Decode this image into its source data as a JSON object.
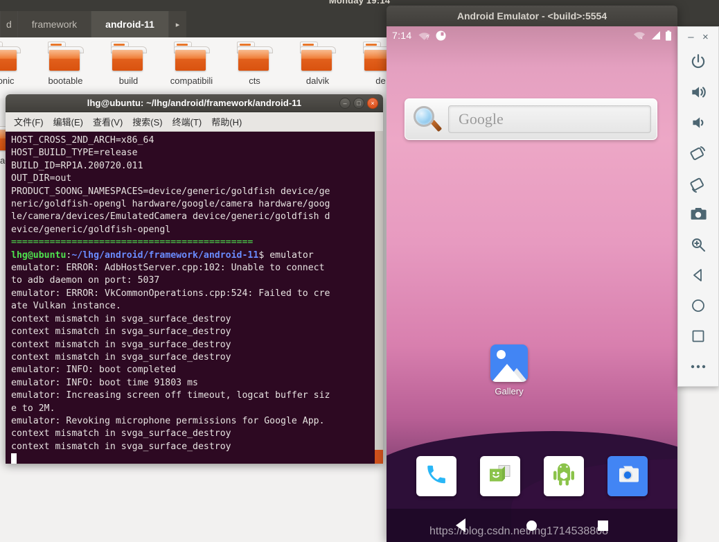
{
  "desktop": {
    "panel_clock": "Monday 19:14",
    "file_manager": {
      "tabs": [
        {
          "label": "d",
          "active": false,
          "partial": true
        },
        {
          "label": "framework",
          "active": false,
          "partial": false
        },
        {
          "label": "android-11",
          "active": true,
          "partial": false
        }
      ],
      "tab_overflow_icon": "chevron-right-icon",
      "folders": [
        {
          "name": "bionic"
        },
        {
          "name": "bootable"
        },
        {
          "name": "build"
        },
        {
          "name": "compatibili"
        },
        {
          "name": "cts"
        },
        {
          "name": "dalvik"
        },
        {
          "name": "de"
        }
      ],
      "hidden_folder_label": "ad"
    }
  },
  "terminal": {
    "title": "lhg@ubuntu: ~/lhg/android/framework/android-11",
    "window_buttons": {
      "minimize": "–",
      "maximize": "□",
      "close": "×"
    },
    "menu": [
      "文件(F)",
      "编辑(E)",
      "查看(V)",
      "搜索(S)",
      "终端(T)",
      "帮助(H)"
    ],
    "lines": [
      {
        "text": "HOST_CROSS_2ND_ARCH=x86_64"
      },
      {
        "text": "HOST_BUILD_TYPE=release"
      },
      {
        "text": "BUILD_ID=RP1A.200720.011"
      },
      {
        "text": "OUT_DIR=out"
      },
      {
        "text": "PRODUCT_SOONG_NAMESPACES=device/generic/goldfish device/ge"
      },
      {
        "text": "neric/goldfish-opengl hardware/google/camera hardware/goog"
      },
      {
        "text": "le/camera/devices/EmulatedCamera device/generic/goldfish d"
      },
      {
        "text": "evice/generic/goldfish-opengl"
      },
      {
        "text": "============================================",
        "style": "sep"
      },
      {
        "prompt_user": "lhg@ubuntu",
        "prompt_sep": ":",
        "prompt_path": "~/lhg/android/framework/android-11",
        "prompt_tail": "$ emulator"
      },
      {
        "text": "emulator: ERROR: AdbHostServer.cpp:102: Unable to connect"
      },
      {
        "text": "to adb daemon on port: 5037"
      },
      {
        "text": "emulator: ERROR: VkCommonOperations.cpp:524: Failed to cre"
      },
      {
        "text": "ate Vulkan instance."
      },
      {
        "text": "context mismatch in svga_surface_destroy"
      },
      {
        "text": "context mismatch in svga_surface_destroy"
      },
      {
        "text": "context mismatch in svga_surface_destroy"
      },
      {
        "text": "context mismatch in svga_surface_destroy"
      },
      {
        "text": "emulator: INFO: boot completed"
      },
      {
        "text": "emulator: INFO: boot time 91803 ms"
      },
      {
        "text": "emulator: Increasing screen off timeout, logcat buffer siz"
      },
      {
        "text": "e to 2M."
      },
      {
        "text": "emulator: Revoking microphone permissions for Google App."
      },
      {
        "text": "context mismatch in svga_surface_destroy"
      },
      {
        "text": "context mismatch in svga_surface_destroy"
      }
    ],
    "colors": {
      "background": "#2d0922",
      "text": "#e6e2e0",
      "prompt_user": "#4ee24e",
      "prompt_path": "#6a8cff"
    }
  },
  "emulator": {
    "window_title": "Android Emulator - <build>:5554",
    "statusbar": {
      "clock": "7:14",
      "left_icons": [
        "wifi-question-icon",
        "sync-circle-icon"
      ],
      "right_icons": [
        "wifi-off-icon",
        "signal-bars-icon",
        "battery-full-icon"
      ]
    },
    "search_widget": {
      "icon": "magnifier-icon",
      "placeholder": "Google"
    },
    "home_apps": [
      {
        "label": "Gallery",
        "icon": "gallery-icon"
      }
    ],
    "dock_apps": [
      {
        "label": "Phone",
        "icon": "phone-icon"
      },
      {
        "label": "Messaging",
        "icon": "messaging-icon"
      },
      {
        "label": "API Demos",
        "icon": "android-icon"
      },
      {
        "label": "Camera",
        "icon": "camera-icon"
      }
    ],
    "navbar": [
      "back-nav-icon",
      "home-nav-icon",
      "recents-nav-icon"
    ],
    "toolbar": {
      "window_buttons": {
        "minimize": "–",
        "close": "×"
      },
      "items": [
        {
          "icon": "power-icon",
          "label": "Power"
        },
        {
          "icon": "volume-up-icon",
          "label": "Volume Up"
        },
        {
          "icon": "volume-down-icon",
          "label": "Volume Down"
        },
        {
          "icon": "rotate-left-icon",
          "label": "Rotate Left"
        },
        {
          "icon": "rotate-right-icon",
          "label": "Rotate Right"
        },
        {
          "icon": "screenshot-camera-icon",
          "label": "Take Screenshot"
        },
        {
          "icon": "zoom-icon",
          "label": "Enable Zoom"
        },
        {
          "icon": "back-icon",
          "label": "Back"
        },
        {
          "icon": "home-icon",
          "label": "Home"
        },
        {
          "icon": "overview-icon",
          "label": "Overview"
        },
        {
          "icon": "more-icon",
          "label": "More"
        }
      ]
    }
  },
  "watermark": "https://blog.csdn.net/lhg1714538808"
}
